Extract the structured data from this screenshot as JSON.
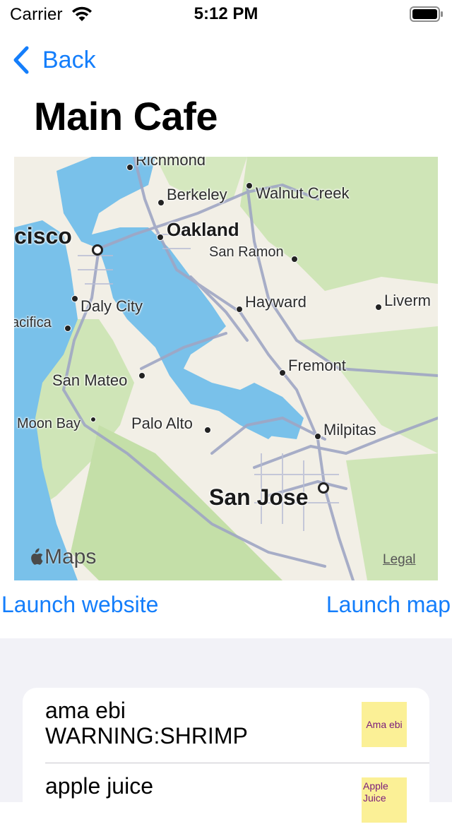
{
  "status_bar": {
    "carrier": "Carrier",
    "time": "5:12 PM"
  },
  "nav": {
    "back_label": "Back"
  },
  "page": {
    "title": "Main Cafe"
  },
  "map": {
    "labels": {
      "richmond": "Richmond",
      "berkeley": "Berkeley",
      "walnut_creek": "Walnut Creek",
      "oakland": "Oakland",
      "san_francisco": "cisco",
      "san_ramon": "San Ramon",
      "daly_city": "Daly City",
      "hayward": "Hayward",
      "livermore": "Liverm",
      "pacifica": "acifica",
      "fremont": "Fremont",
      "san_mateo": "San Mateo",
      "moon_bay": "Moon Bay",
      "palo_alto": "Palo Alto",
      "milpitas": "Milpitas",
      "san_jose": "San Jose"
    },
    "attribution": "Maps",
    "legal": "Legal",
    "colors": {
      "water": "#79c1ea",
      "land": "#f2efe6",
      "park": "#c9e2b0",
      "road": "#9fa6c4"
    }
  },
  "actions": {
    "launch_website": "Launch website",
    "launch_map": "Launch map"
  },
  "menu_items": [
    {
      "name": "ama ebi",
      "warning": "WARNING:SHRIMP",
      "thumb_label": "Ama ebi"
    },
    {
      "name": "apple juice",
      "warning": "",
      "thumb_label": "Apple Juice"
    }
  ]
}
